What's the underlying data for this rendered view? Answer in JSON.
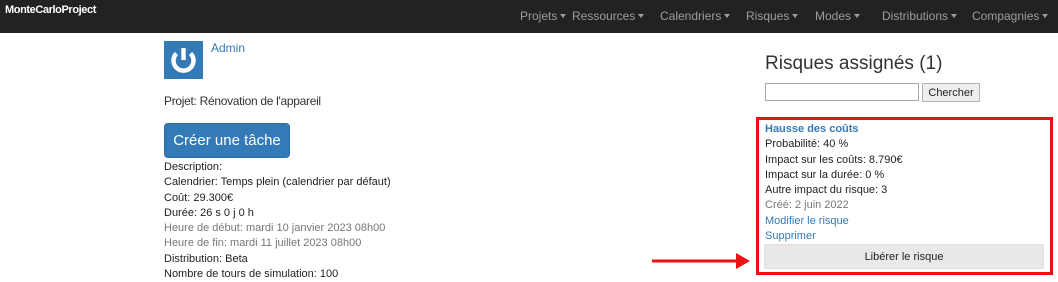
{
  "navbar": {
    "brand": "MonteCarloProject",
    "items": [
      {
        "label": "Projets"
      },
      {
        "label": "Ressources"
      },
      {
        "label": "Calendriers"
      },
      {
        "label": "Risques"
      },
      {
        "label": "Modes"
      },
      {
        "label": "Distributions"
      },
      {
        "label": "Compagnies"
      }
    ]
  },
  "user": {
    "name": "Admin",
    "avatar_icon": "power-icon"
  },
  "project": {
    "label": "Projet: Rénovation de l'appareil",
    "create_task_label": "Créer une tâche"
  },
  "details": {
    "description": "Description:",
    "calendrier": "Calendrier: Temps plein (calendrier par défaut)",
    "cout": "Coût: 29.300€",
    "duree": "Durée: 26 s 0 j 0 h",
    "debut": "Heure de début: mardi 10 janvier 2023 08h00",
    "fin": "Heure de fin: mardi 11 juillet 2023 08h00",
    "distribution": "Distribution: Beta",
    "tours": "Nombre de tours de simulation: 100"
  },
  "risks": {
    "title": "Risques assignés (1)",
    "search": {
      "value": "",
      "placeholder": "",
      "button_label": "Chercher"
    },
    "item": {
      "name": "Hausse des coûts",
      "probabilite": "Probabilité: 40 %",
      "impact_couts": "Impact sur les coûts: 8.790€",
      "impact_duree": "Impact sur la durée: 0 %",
      "autre_impact": "Autre impact du risque: 3",
      "cree": "Créé: 2 juin 2022",
      "modifier_label": "Modifier le risque",
      "supprimer_label": "Supprimer",
      "liberer_label": "Libérer le risque"
    }
  },
  "colors": {
    "navbar": "#222222",
    "primary": "#337ab7",
    "highlight": "#ee1111"
  }
}
